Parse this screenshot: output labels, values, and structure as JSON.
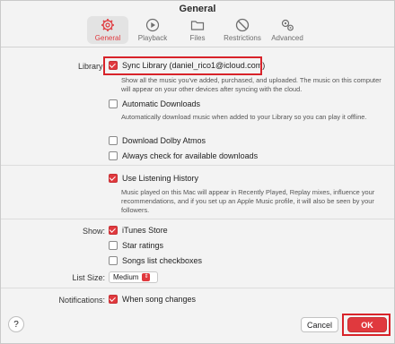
{
  "window": {
    "title": "General"
  },
  "tabs": [
    {
      "label": "General",
      "icon": "gear-icon",
      "active": true
    },
    {
      "label": "Playback",
      "icon": "play-icon",
      "active": false
    },
    {
      "label": "Files",
      "icon": "folder-icon",
      "active": false
    },
    {
      "label": "Restrictions",
      "icon": "no-entry-icon",
      "active": false
    },
    {
      "label": "Advanced",
      "icon": "gears-icon",
      "active": false
    }
  ],
  "library": {
    "label": "Library:",
    "sync": {
      "label": "Sync Library (daniel_rico1@icloud.com)",
      "checked": true,
      "description": "Show all the music you've added, purchased, and uploaded. The music on this computer will appear on your other devices after syncing with the cloud."
    },
    "auto_downloads": {
      "label": "Automatic Downloads",
      "checked": false,
      "description": "Automatically download music when added to your Library so you can play it offline."
    },
    "dolby": {
      "label": "Download Dolby Atmos",
      "checked": false
    },
    "always_check": {
      "label": "Always check for available downloads",
      "checked": false
    }
  },
  "listening": {
    "label": "Use Listening History",
    "checked": true,
    "description": "Music played on this Mac will appear in Recently Played, Replay mixes, influence your recommendations, and if you set up an Apple Music profile, it will also be seen by your followers."
  },
  "show": {
    "label": "Show:",
    "itunes": {
      "label": "iTunes Store",
      "checked": true
    },
    "star": {
      "label": "Star ratings",
      "checked": false
    },
    "songs": {
      "label": "Songs list checkboxes",
      "checked": false
    }
  },
  "list_size": {
    "label": "List Size:",
    "value": "Medium"
  },
  "notifications": {
    "label": "Notifications:",
    "song": {
      "label": "When song changes",
      "checked": true
    }
  },
  "footer": {
    "help": "?",
    "cancel": "Cancel",
    "ok": "OK"
  },
  "colors": {
    "accent": "#e0393e",
    "highlight": "#d8232a"
  }
}
